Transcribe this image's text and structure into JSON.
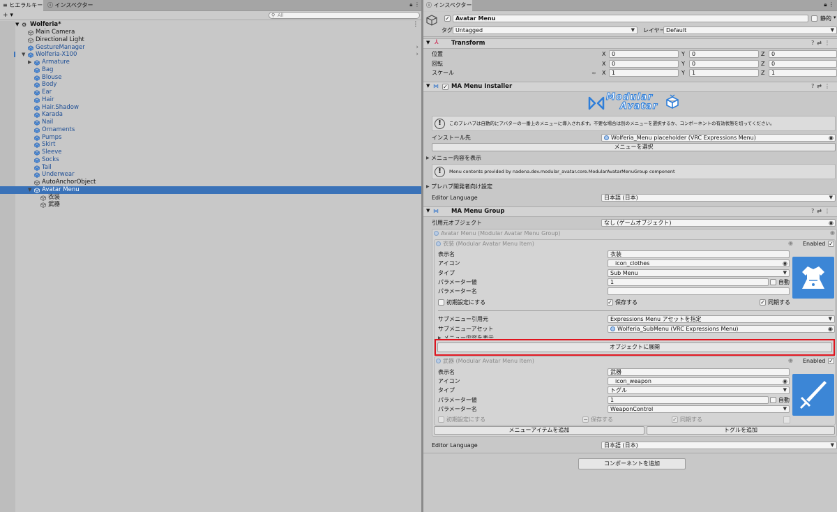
{
  "hierarchy": {
    "tab_label": "ヒエラルキー",
    "tab2_label": "インスペクター",
    "add_label": "+ ▾",
    "search_placeholder": "All",
    "scene_name": "Wolferia*",
    "objects": [
      {
        "label": "Main Camera",
        "indent": 1,
        "blue": false
      },
      {
        "label": "Directional Light",
        "indent": 1,
        "blue": false
      },
      {
        "label": "GestureManager",
        "indent": 1,
        "blue": true
      },
      {
        "label": "Wolferia-X100",
        "indent": 1,
        "blue": true,
        "fold": "▼"
      },
      {
        "label": "Armature",
        "indent": 2,
        "blue": true,
        "fold": "▶"
      },
      {
        "label": "Bag",
        "indent": 2,
        "blue": true
      },
      {
        "label": "Blouse",
        "indent": 2,
        "blue": true
      },
      {
        "label": "Body",
        "indent": 2,
        "blue": true
      },
      {
        "label": "Ear",
        "indent": 2,
        "blue": true
      },
      {
        "label": "Hair",
        "indent": 2,
        "blue": true
      },
      {
        "label": "Hair.Shadow",
        "indent": 2,
        "blue": true
      },
      {
        "label": "Karada",
        "indent": 2,
        "blue": true
      },
      {
        "label": "Nail",
        "indent": 2,
        "blue": true
      },
      {
        "label": "Ornaments",
        "indent": 2,
        "blue": true
      },
      {
        "label": "Pumps",
        "indent": 2,
        "blue": true
      },
      {
        "label": "Skirt",
        "indent": 2,
        "blue": true
      },
      {
        "label": "Sleeve",
        "indent": 2,
        "blue": true
      },
      {
        "label": "Socks",
        "indent": 2,
        "blue": true
      },
      {
        "label": "Tail",
        "indent": 2,
        "blue": true
      },
      {
        "label": "Underwear",
        "indent": 2,
        "blue": true
      },
      {
        "label": "AutoAnchorObject",
        "indent": 2,
        "blue": false
      },
      {
        "label": "Avatar Menu",
        "indent": 2,
        "blue": false,
        "fold": "▼",
        "selected": true
      },
      {
        "label": "衣装",
        "indent": 3,
        "blue": false
      },
      {
        "label": "武器",
        "indent": 3,
        "blue": false
      }
    ]
  },
  "inspector": {
    "tab_label": "インスペクター",
    "object_name": "Avatar Menu",
    "static_label": "静的",
    "tag_label": "タグ",
    "tag_value": "Untagged",
    "layer_label": "レイヤー",
    "layer_value": "Default",
    "transform": {
      "title": "Transform",
      "position_label": "位置",
      "rotation_label": "回転",
      "scale_label": "スケール",
      "x": "X",
      "y": "Y",
      "z": "Z",
      "pos": [
        "0",
        "0",
        "0"
      ],
      "rot": [
        "0",
        "0",
        "0"
      ],
      "scl": [
        "1",
        "1",
        "1"
      ]
    },
    "installer": {
      "title": "MA Menu Installer",
      "logo_line1": "Modular",
      "logo_line2": "Avatar",
      "help_text": "このプレハブは自動的にアバターの一番上のメニューに導入されます。不要な場合は別のメニューを選択するか、コンポーネントの有効状態を切ってください。",
      "install_target_label": "インストール先",
      "install_target_value": "Wolferia_Menu placeholder (VRC Expressions Menu)",
      "select_menu_button": "メニューを選択",
      "show_menu_contents": "メニュー内容を表示",
      "menu_contents_text": "Menu contents provided by nadena.dev.modular_avatar.core.ModularAvatarMenuGroup component",
      "prefab_dev_settings": "プレハブ開発者向け設定",
      "editor_language_label": "Editor Language",
      "editor_language_value": "日本語 (日本)"
    },
    "group": {
      "title": "MA Menu Group",
      "source_object_label": "引用元オブジェクト",
      "source_object_value": "なし (ゲームオブジェクト)",
      "group_header": "Avatar Menu (Modular Avatar Menu Group)",
      "item1": {
        "header": "衣装 (Modular Avatar Menu Item)",
        "enabled_label": "Enabled",
        "display_name_label": "表示名",
        "display_name_value": "衣装",
        "icon_label": "アイコン",
        "icon_value": "icon_clothes",
        "type_label": "タイプ",
        "type_value": "Sub Menu",
        "param_value_label": "パラメーター値",
        "param_value_value": "1",
        "auto_label": "自動",
        "param_name_label": "パラメーター名",
        "param_name_value": "",
        "initial_label": "初期設定にする",
        "save_label": "保存する",
        "sync_label": "同期する",
        "submenu_source_label": "サブメニュー引用元",
        "submenu_source_value": "Expressions Menu アセットを指定",
        "submenu_asset_label": "サブメニューアセット",
        "submenu_asset_value": "Wolferia_SubMenu (VRC Expressions Menu)",
        "show_menu_contents": "メニュー内容を表示",
        "expand_button": "オブジェクトに展開"
      },
      "item2": {
        "header": "武器 (Modular Avatar Menu Item)",
        "enabled_label": "Enabled",
        "display_name_label": "表示名",
        "display_name_value": "武器",
        "icon_label": "アイコン",
        "icon_value": "icon_weapon",
        "type_label": "タイプ",
        "type_value": "トグル",
        "param_value_label": "パラメーター値",
        "param_value_value": "1",
        "auto_label": "自動",
        "param_name_label": "パラメーター名",
        "param_name_value": "WeaponControl",
        "initial_label": "初期設定にする",
        "save_label": "保存する",
        "sync_label": "同期する"
      },
      "add_menu_item_button": "メニューアイテムを追加",
      "add_toggle_button": "トグルを追加",
      "editor_language_label": "Editor Language",
      "editor_language_value": "日本語 (日本)"
    },
    "add_component_button": "コンポーネントを追加"
  },
  "colors": {
    "selection": "#3a72b8",
    "prefab_blue": "#1c4d94",
    "highlight_red": "#e0141e",
    "icon_blue": "#3c86d6"
  }
}
